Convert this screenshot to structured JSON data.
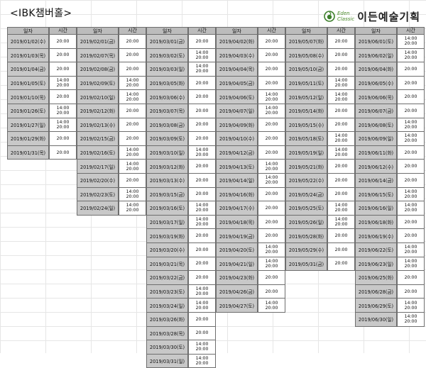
{
  "title": "<IBK챔버홀>",
  "brand": {
    "small_top": "Eden",
    "small_bottom": "Classic",
    "name": "이든예술기획"
  },
  "header": {
    "date": "일자",
    "time": "시간"
  },
  "columns": [
    {
      "rows": [
        [
          "2019/01/02(수)",
          "20:00"
        ],
        [
          "2019/01/03(목)",
          "20:00"
        ],
        [
          "2019/01/04(금)",
          "20:00"
        ],
        [
          "2019/01/05(토)",
          "14:00|20:00"
        ],
        [
          "2019/01/10(목)",
          "20:00"
        ],
        [
          "2019/01/26(토)",
          "14:00|20:00"
        ],
        [
          "2019/01/27(일)",
          "14:00|20:00"
        ],
        [
          "2019/01/29(화)",
          "20:00"
        ],
        [
          "2019/01/31(목)",
          "20:00"
        ]
      ]
    },
    {
      "rows": [
        [
          "2019/02/01(금)",
          "20:00"
        ],
        [
          "2019/02/07(목)",
          "20:00"
        ],
        [
          "2019/02/08(금)",
          "20:00"
        ],
        [
          "2019/02/09(토)",
          "14:00|20:00"
        ],
        [
          "2019/02/10(일)",
          "14:00|20:00"
        ],
        [
          "2019/02/12(화)",
          "20:00"
        ],
        [
          "2019/02/13(수)",
          "20:00"
        ],
        [
          "2019/02/15(금)",
          "20:00"
        ],
        [
          "2019/02/16(토)",
          "14:00|20:00"
        ],
        [
          "2019/02/17(일)",
          "14:00|20:00"
        ],
        [
          "2019/02/20(수)",
          "20:00"
        ],
        [
          "2019/02/23(토)",
          "14:00|20:00"
        ],
        [
          "2019/02/24(일)",
          "14:00|20:00"
        ]
      ]
    },
    {
      "rows": [
        [
          "2019/03/01(금)",
          "20:00"
        ],
        [
          "2019/03/02(토)",
          "14:00|20:00"
        ],
        [
          "2019/03/03(일)",
          "14:00|20:00"
        ],
        [
          "2019/03/05(화)",
          "20:00"
        ],
        [
          "2019/03/06(수)",
          "20:00"
        ],
        [
          "2019/03/07(목)",
          "20:00"
        ],
        [
          "2019/03/08(금)",
          "20:00"
        ],
        [
          "2019/03/09(토)",
          "20:00"
        ],
        [
          "2019/03/10(일)",
          "14:00|20:00"
        ],
        [
          "2019/03/12(화)",
          "20:00"
        ],
        [
          "2019/03/13(수)",
          "20:00"
        ],
        [
          "2019/03/15(금)",
          "20:00"
        ],
        [
          "2019/03/16(토)",
          "14:00|20:00"
        ],
        [
          "2019/03/17(일)",
          "14:00|20:00"
        ],
        [
          "2019/03/19(화)",
          "20:00"
        ],
        [
          "2019/03/20(수)",
          "20:00"
        ],
        [
          "2019/03/21(목)",
          "20:00"
        ],
        [
          "2019/03/22(금)",
          "20:00"
        ],
        [
          "2019/03/23(토)",
          "14:00|20:00"
        ],
        [
          "2019/03/24(일)",
          "14:00|20:00"
        ],
        [
          "2019/03/26(화)",
          "20:00"
        ],
        [
          "2019/03/28(목)",
          "20:00"
        ],
        [
          "2019/03/30(토)",
          "14:00|20:00"
        ],
        [
          "2019/03/31(일)",
          "14:00|20:00"
        ]
      ]
    },
    {
      "rows": [
        [
          "2019/04/02(화)",
          "20:00"
        ],
        [
          "2019/04/03(수)",
          "20:00"
        ],
        [
          "2019/04/04(목)",
          "20:00"
        ],
        [
          "2019/04/05(금)",
          "20:00"
        ],
        [
          "2019/04/06(토)",
          "14:00|20:00"
        ],
        [
          "2019/04/07(일)",
          "14:00|20:00"
        ],
        [
          "2019/04/09(화)",
          "20:00"
        ],
        [
          "2019/04/10(수)",
          "20:00"
        ],
        [
          "2019/04/12(금)",
          "20:00"
        ],
        [
          "2019/04/13(토)",
          "14:00|20:00"
        ],
        [
          "2019/04/14(일)",
          "14:00|20:00"
        ],
        [
          "2019/04/16(화)",
          "20:00"
        ],
        [
          "2019/04/17(수)",
          "20:00"
        ],
        [
          "2019/04/18(목)",
          "20:00"
        ],
        [
          "2019/04/19(금)",
          "20:00"
        ],
        [
          "2019/04/20(토)",
          "14:00|20:00"
        ],
        [
          "2019/04/21(일)",
          "14:00|20:00"
        ],
        [
          "2019/04/23(화)",
          "20:00"
        ],
        [
          "2019/04/26(금)",
          "20:00"
        ],
        [
          "2019/04/27(토)",
          "14:00|20:00"
        ]
      ]
    },
    {
      "rows": [
        [
          "2019/05/07(화)",
          "20:00"
        ],
        [
          "2019/05/08(수)",
          "20:00"
        ],
        [
          "2019/05/10(금)",
          "20:00"
        ],
        [
          "2019/05/11(토)",
          "14:00|20:00"
        ],
        [
          "2019/05/12(일)",
          "14:00|20:00"
        ],
        [
          "2019/05/14(화)",
          "20:00"
        ],
        [
          "2019/05/15(수)",
          "20:00"
        ],
        [
          "2019/05/18(토)",
          "14:00|20:00"
        ],
        [
          "2019/05/19(일)",
          "14:00|20:00"
        ],
        [
          "2019/05/21(화)",
          "20:00"
        ],
        [
          "2019/05/22(수)",
          "20:00"
        ],
        [
          "2019/05/24(금)",
          "20:00"
        ],
        [
          "2019/05/25(토)",
          "14:00|20:00"
        ],
        [
          "2019/05/26(일)",
          "14:00|20:00"
        ],
        [
          "2019/05/28(화)",
          "20:00"
        ],
        [
          "2019/05/29(수)",
          "20:00"
        ],
        [
          "2019/05/31(금)",
          "20:00"
        ]
      ]
    },
    {
      "rows": [
        [
          "2019/06/01(토)",
          "14:00|20:00"
        ],
        [
          "2019/06/02(일)",
          "14:00|20:00"
        ],
        [
          "2019/06/04(화)",
          "20:00"
        ],
        [
          "2019/06/05(수)",
          "20:00"
        ],
        [
          "2019/06/06(목)",
          "20:00"
        ],
        [
          "2019/06/07(금)",
          "20:00"
        ],
        [
          "2019/06/08(토)",
          "14:00|20:00"
        ],
        [
          "2019/06/09(일)",
          "14:00|20:00"
        ],
        [
          "2019/06/11(화)",
          "20:00"
        ],
        [
          "2019/06/12(수)",
          "20:00"
        ],
        [
          "2019/06/14(금)",
          "20:00"
        ],
        [
          "2019/06/15(토)",
          "14:00|20:00"
        ],
        [
          "2019/06/16(일)",
          "14:00|20:00"
        ],
        [
          "2019/06/18(화)",
          "20:00"
        ],
        [
          "2019/06/19(수)",
          "20:00"
        ],
        [
          "2019/06/22(토)",
          "14:00|20:00"
        ],
        [
          "2019/06/23(일)",
          "14:00|20:00"
        ],
        [
          "2019/06/25(화)",
          "20:00"
        ],
        [
          "2019/06/28(금)",
          "20:00"
        ],
        [
          "2019/06/29(토)",
          "14:00|20:00"
        ],
        [
          "2019/06/30(일)",
          "14:00|20:00"
        ]
      ]
    }
  ]
}
